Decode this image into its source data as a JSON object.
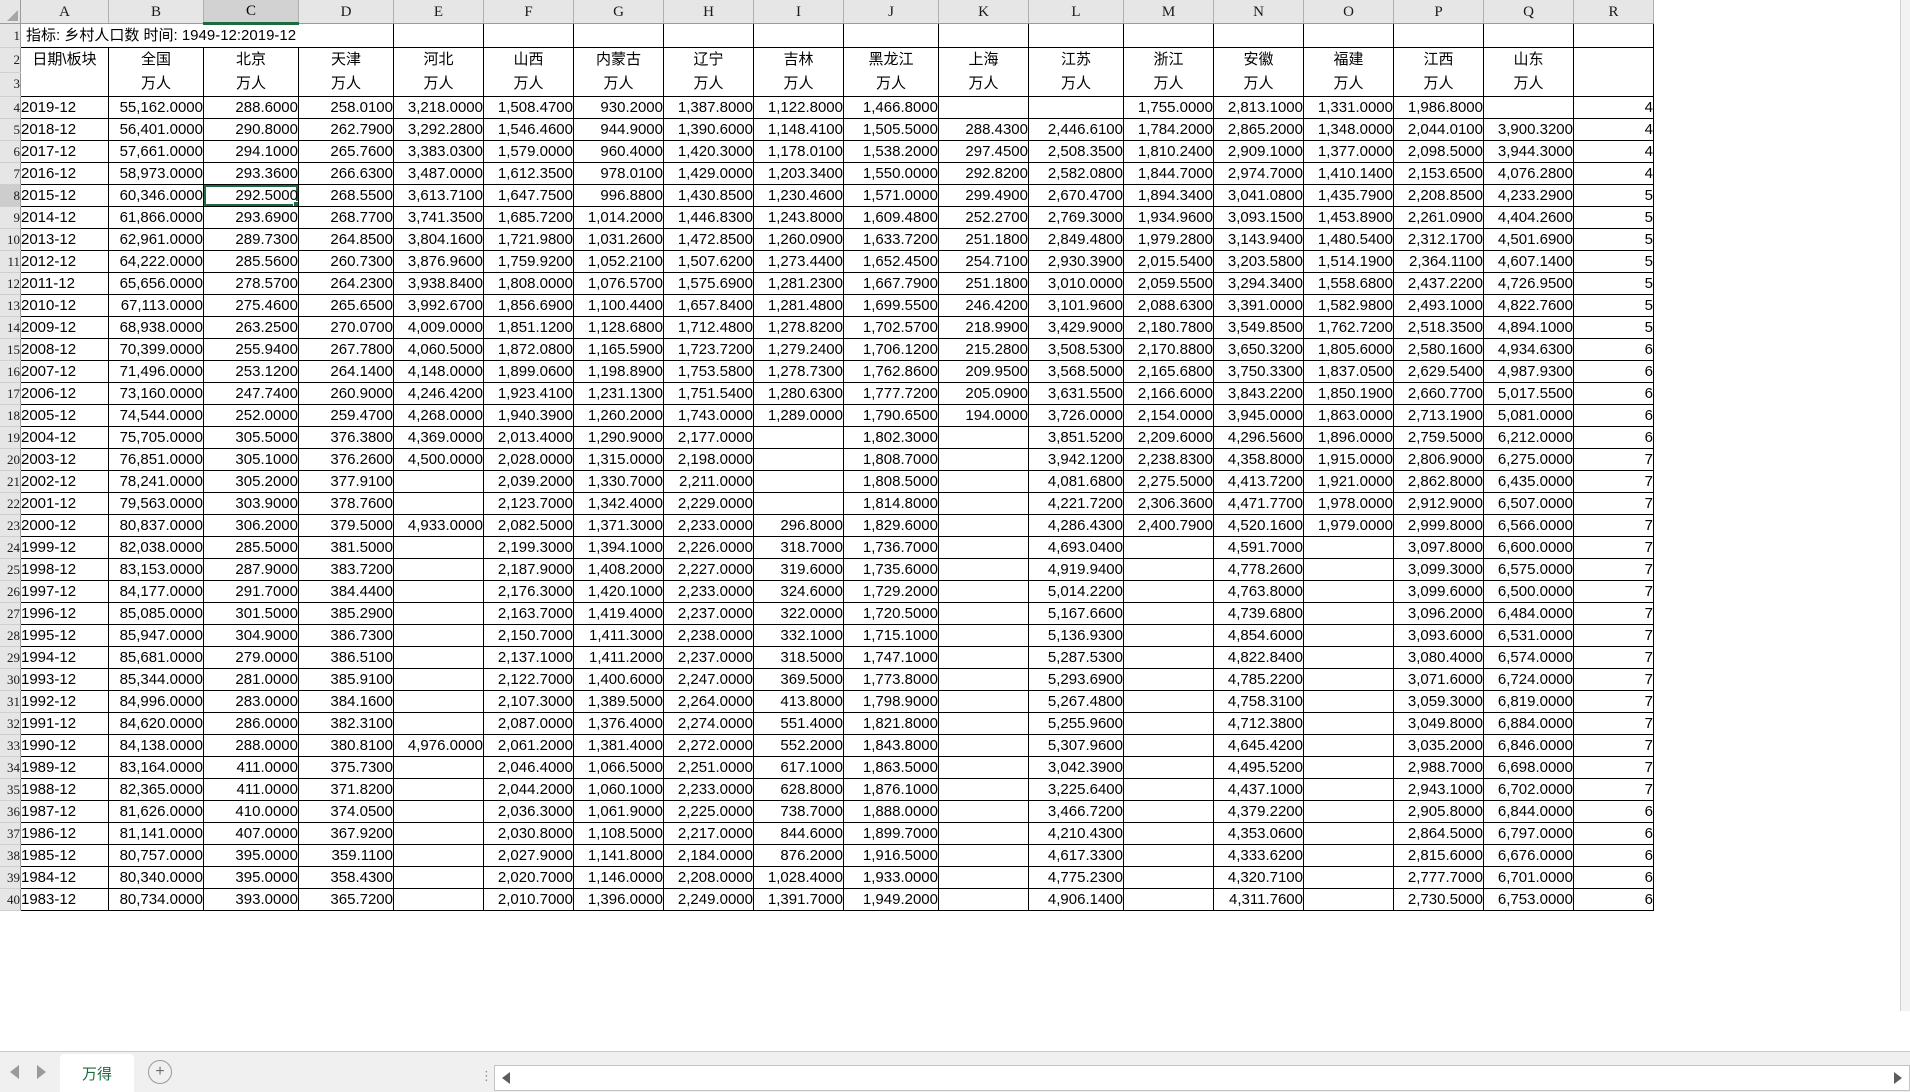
{
  "window": {
    "sheet_tab": "万得",
    "add_sheet_icon": "plus-circle-icon",
    "nav_prev_icon": "triangle-left-icon",
    "nav_next_icon": "triangle-right-icon",
    "hscroll_left_icon": "triangle-left-icon",
    "hscroll_right_icon": "triangle-right-icon",
    "accent_color": "#1e6b41"
  },
  "grid": {
    "column_letters": [
      "A",
      "B",
      "C",
      "D",
      "E",
      "F",
      "G",
      "H",
      "I",
      "J",
      "K",
      "L",
      "M",
      "N",
      "O",
      "P",
      "Q",
      "R"
    ],
    "selected_column": "C",
    "selected_cell": "C8",
    "selected_row_number": "8",
    "row_numbers": [
      "1",
      "2",
      "3",
      "4",
      "5",
      "6",
      "7",
      "8",
      "9",
      "10",
      "11",
      "12",
      "13",
      "14",
      "15",
      "16",
      "17",
      "18",
      "19",
      "20",
      "21",
      "22",
      "23",
      "24",
      "25",
      "26",
      "27",
      "28",
      "29",
      "30",
      "31",
      "32",
      "33",
      "34",
      "35",
      "36",
      "37",
      "38",
      "39",
      "40"
    ],
    "title": "指标: 乡村人口数  时间: 1949-12:2019-12",
    "header_label": "日期\\板块",
    "unit": "万人",
    "provinces": [
      "全国",
      "北京",
      "天津",
      "河北",
      "山西",
      "内蒙古",
      "辽宁",
      "吉林",
      "黑龙江",
      "上海",
      "江苏",
      "浙江",
      "安徽",
      "福建",
      "江西",
      "山东"
    ]
  },
  "chart_data": {
    "type": "table",
    "title": "指标: 乡村人口数  时间: 1949-12:2019-12",
    "ylabel": "万人",
    "categories": [
      "日期\\板块",
      "全国",
      "北京",
      "天津",
      "河北",
      "山西",
      "内蒙古",
      "辽宁",
      "吉林",
      "黑龙江",
      "上海",
      "江苏",
      "浙江",
      "安徽",
      "福建",
      "江西",
      "山东"
    ],
    "rows": [
      [
        "2019-12",
        "55,162.0000",
        "288.6000",
        "258.0100",
        "3,218.0000",
        "1,508.4700",
        "930.2000",
        "1,387.8000",
        "1,122.8000",
        "1,466.8000",
        "",
        "",
        "1,755.0000",
        "2,813.1000",
        "1,331.0000",
        "1,986.8000",
        "",
        "4"
      ],
      [
        "2018-12",
        "56,401.0000",
        "290.8000",
        "262.7900",
        "3,292.2800",
        "1,546.4600",
        "944.9000",
        "1,390.6000",
        "1,148.4100",
        "1,505.5000",
        "288.4300",
        "2,446.6100",
        "1,784.2000",
        "2,865.2000",
        "1,348.0000",
        "2,044.0100",
        "3,900.3200",
        "4"
      ],
      [
        "2017-12",
        "57,661.0000",
        "294.1000",
        "265.7600",
        "3,383.0300",
        "1,579.0000",
        "960.4000",
        "1,420.3000",
        "1,178.0100",
        "1,538.2000",
        "297.4500",
        "2,508.3500",
        "1,810.2400",
        "2,909.1000",
        "1,377.0000",
        "2,098.5000",
        "3,944.3000",
        "4"
      ],
      [
        "2016-12",
        "58,973.0000",
        "293.3600",
        "266.6300",
        "3,487.0000",
        "1,612.3500",
        "978.0100",
        "1,429.0000",
        "1,203.3400",
        "1,550.0000",
        "292.8200",
        "2,582.0800",
        "1,844.7000",
        "2,974.7000",
        "1,410.1400",
        "2,153.6500",
        "4,076.2800",
        "4"
      ],
      [
        "2015-12",
        "60,346.0000",
        "292.5000",
        "268.5500",
        "3,613.7100",
        "1,647.7500",
        "996.8800",
        "1,430.8500",
        "1,230.4600",
        "1,571.0000",
        "299.4900",
        "2,670.4700",
        "1,894.3400",
        "3,041.0800",
        "1,435.7900",
        "2,208.8500",
        "4,233.2900",
        "5"
      ],
      [
        "2014-12",
        "61,866.0000",
        "293.6900",
        "268.7700",
        "3,741.3500",
        "1,685.7200",
        "1,014.2000",
        "1,446.8300",
        "1,243.8000",
        "1,609.4800",
        "252.2700",
        "2,769.3000",
        "1,934.9600",
        "3,093.1500",
        "1,453.8900",
        "2,261.0900",
        "4,404.2600",
        "5"
      ],
      [
        "2013-12",
        "62,961.0000",
        "289.7300",
        "264.8500",
        "3,804.1600",
        "1,721.9800",
        "1,031.2600",
        "1,472.8500",
        "1,260.0900",
        "1,633.7200",
        "251.1800",
        "2,849.4800",
        "1,979.2800",
        "3,143.9400",
        "1,480.5400",
        "2,312.1700",
        "4,501.6900",
        "5"
      ],
      [
        "2012-12",
        "64,222.0000",
        "285.5600",
        "260.7300",
        "3,876.9600",
        "1,759.9200",
        "1,052.2100",
        "1,507.6200",
        "1,273.4400",
        "1,652.4500",
        "254.7100",
        "2,930.3900",
        "2,015.5400",
        "3,203.5800",
        "1,514.1900",
        "2,364.1100",
        "4,607.1400",
        "5"
      ],
      [
        "2011-12",
        "65,656.0000",
        "278.5700",
        "264.2300",
        "3,938.8400",
        "1,808.0000",
        "1,076.5700",
        "1,575.6900",
        "1,281.2300",
        "1,667.7900",
        "251.1800",
        "3,010.0000",
        "2,059.5500",
        "3,294.3400",
        "1,558.6800",
        "2,437.2200",
        "4,726.9500",
        "5"
      ],
      [
        "2010-12",
        "67,113.0000",
        "275.4600",
        "265.6500",
        "3,992.6700",
        "1,856.6900",
        "1,100.4400",
        "1,657.8400",
        "1,281.4800",
        "1,699.5500",
        "246.4200",
        "3,101.9600",
        "2,088.6300",
        "3,391.0000",
        "1,582.9800",
        "2,493.1000",
        "4,822.7600",
        "5"
      ],
      [
        "2009-12",
        "68,938.0000",
        "263.2500",
        "270.0700",
        "4,009.0000",
        "1,851.1200",
        "1,128.6800",
        "1,712.4800",
        "1,278.8200",
        "1,702.5700",
        "218.9900",
        "3,429.9000",
        "2,180.7800",
        "3,549.8500",
        "1,762.7200",
        "2,518.3500",
        "4,894.1000",
        "5"
      ],
      [
        "2008-12",
        "70,399.0000",
        "255.9400",
        "267.7800",
        "4,060.5000",
        "1,872.0800",
        "1,165.5900",
        "1,723.7200",
        "1,279.2400",
        "1,706.1200",
        "215.2800",
        "3,508.5300",
        "2,170.8800",
        "3,650.3200",
        "1,805.6000",
        "2,580.1600",
        "4,934.6300",
        "6"
      ],
      [
        "2007-12",
        "71,496.0000",
        "253.1200",
        "264.1400",
        "4,148.0000",
        "1,899.0600",
        "1,198.8900",
        "1,753.5800",
        "1,278.7300",
        "1,762.8600",
        "209.9500",
        "3,568.5000",
        "2,165.6800",
        "3,750.3300",
        "1,837.0500",
        "2,629.5400",
        "4,987.9300",
        "6"
      ],
      [
        "2006-12",
        "73,160.0000",
        "247.7400",
        "260.9000",
        "4,246.4200",
        "1,923.4100",
        "1,231.1300",
        "1,751.5400",
        "1,280.6300",
        "1,777.7200",
        "205.0900",
        "3,631.5500",
        "2,166.6000",
        "3,843.2200",
        "1,850.1900",
        "2,660.7700",
        "5,017.5500",
        "6"
      ],
      [
        "2005-12",
        "74,544.0000",
        "252.0000",
        "259.4700",
        "4,268.0000",
        "1,940.3900",
        "1,260.2000",
        "1,743.0000",
        "1,289.0000",
        "1,790.6500",
        "194.0000",
        "3,726.0000",
        "2,154.0000",
        "3,945.0000",
        "1,863.0000",
        "2,713.1900",
        "5,081.0000",
        "6"
      ],
      [
        "2004-12",
        "75,705.0000",
        "305.5000",
        "376.3800",
        "4,369.0000",
        "2,013.4000",
        "1,290.9000",
        "2,177.0000",
        "",
        "1,802.3000",
        "",
        "3,851.5200",
        "2,209.6000",
        "4,296.5600",
        "1,896.0000",
        "2,759.5000",
        "6,212.0000",
        "6"
      ],
      [
        "2003-12",
        "76,851.0000",
        "305.1000",
        "376.2600",
        "4,500.0000",
        "2,028.0000",
        "1,315.0000",
        "2,198.0000",
        "",
        "1,808.7000",
        "",
        "3,942.1200",
        "2,238.8300",
        "4,358.8000",
        "1,915.0000",
        "2,806.9000",
        "6,275.0000",
        "7"
      ],
      [
        "2002-12",
        "78,241.0000",
        "305.2000",
        "377.9100",
        "",
        "2,039.2000",
        "1,330.7000",
        "2,211.0000",
        "",
        "1,808.5000",
        "",
        "4,081.6800",
        "2,275.5000",
        "4,413.7200",
        "1,921.0000",
        "2,862.8000",
        "6,435.0000",
        "7"
      ],
      [
        "2001-12",
        "79,563.0000",
        "303.9000",
        "378.7600",
        "",
        "2,123.7000",
        "1,342.4000",
        "2,229.0000",
        "",
        "1,814.8000",
        "",
        "4,221.7200",
        "2,306.3600",
        "4,471.7700",
        "1,978.0000",
        "2,912.9000",
        "6,507.0000",
        "7"
      ],
      [
        "2000-12",
        "80,837.0000",
        "306.2000",
        "379.5000",
        "4,933.0000",
        "2,082.5000",
        "1,371.3000",
        "2,233.0000",
        "296.8000",
        "1,829.6000",
        "",
        "4,286.4300",
        "2,400.7900",
        "4,520.1600",
        "1,979.0000",
        "2,999.8000",
        "6,566.0000",
        "7"
      ],
      [
        "1999-12",
        "82,038.0000",
        "285.5000",
        "381.5000",
        "",
        "2,199.3000",
        "1,394.1000",
        "2,226.0000",
        "318.7000",
        "1,736.7000",
        "",
        "4,693.0400",
        "",
        "4,591.7000",
        "",
        "3,097.8000",
        "6,600.0000",
        "7"
      ],
      [
        "1998-12",
        "83,153.0000",
        "287.9000",
        "383.7200",
        "",
        "2,187.9000",
        "1,408.2000",
        "2,227.0000",
        "319.6000",
        "1,735.6000",
        "",
        "4,919.9400",
        "",
        "4,778.2600",
        "",
        "3,099.3000",
        "6,575.0000",
        "7"
      ],
      [
        "1997-12",
        "84,177.0000",
        "291.7000",
        "384.4400",
        "",
        "2,176.3000",
        "1,420.1000",
        "2,233.0000",
        "324.6000",
        "1,729.2000",
        "",
        "5,014.2200",
        "",
        "4,763.8000",
        "",
        "3,099.6000",
        "6,500.0000",
        "7"
      ],
      [
        "1996-12",
        "85,085.0000",
        "301.5000",
        "385.2900",
        "",
        "2,163.7000",
        "1,419.4000",
        "2,237.0000",
        "322.0000",
        "1,720.5000",
        "",
        "5,167.6600",
        "",
        "4,739.6800",
        "",
        "3,096.2000",
        "6,484.0000",
        "7"
      ],
      [
        "1995-12",
        "85,947.0000",
        "304.9000",
        "386.7300",
        "",
        "2,150.7000",
        "1,411.3000",
        "2,238.0000",
        "332.1000",
        "1,715.1000",
        "",
        "5,136.9300",
        "",
        "4,854.6000",
        "",
        "3,093.6000",
        "6,531.0000",
        "7"
      ],
      [
        "1994-12",
        "85,681.0000",
        "279.0000",
        "386.5100",
        "",
        "2,137.1000",
        "1,411.2000",
        "2,237.0000",
        "318.5000",
        "1,747.1000",
        "",
        "5,287.5300",
        "",
        "4,822.8400",
        "",
        "3,080.4000",
        "6,574.0000",
        "7"
      ],
      [
        "1993-12",
        "85,344.0000",
        "281.0000",
        "385.9100",
        "",
        "2,122.7000",
        "1,400.6000",
        "2,247.0000",
        "369.5000",
        "1,773.8000",
        "",
        "5,293.6900",
        "",
        "4,785.2200",
        "",
        "3,071.6000",
        "6,724.0000",
        "7"
      ],
      [
        "1992-12",
        "84,996.0000",
        "283.0000",
        "384.1600",
        "",
        "2,107.3000",
        "1,389.5000",
        "2,264.0000",
        "413.8000",
        "1,798.9000",
        "",
        "5,267.4800",
        "",
        "4,758.3100",
        "",
        "3,059.3000",
        "6,819.0000",
        "7"
      ],
      [
        "1991-12",
        "84,620.0000",
        "286.0000",
        "382.3100",
        "",
        "2,087.0000",
        "1,376.4000",
        "2,274.0000",
        "551.4000",
        "1,821.8000",
        "",
        "5,255.9600",
        "",
        "4,712.3800",
        "",
        "3,049.8000",
        "6,884.0000",
        "7"
      ],
      [
        "1990-12",
        "84,138.0000",
        "288.0000",
        "380.8100",
        "4,976.0000",
        "2,061.2000",
        "1,381.4000",
        "2,272.0000",
        "552.2000",
        "1,843.8000",
        "",
        "5,307.9600",
        "",
        "4,645.4200",
        "",
        "3,035.2000",
        "6,846.0000",
        "7"
      ],
      [
        "1989-12",
        "83,164.0000",
        "411.0000",
        "375.7300",
        "",
        "2,046.4000",
        "1,066.5000",
        "2,251.0000",
        "617.1000",
        "1,863.5000",
        "",
        "3,042.3900",
        "",
        "4,495.5200",
        "",
        "2,988.7000",
        "6,698.0000",
        "7"
      ],
      [
        "1988-12",
        "82,365.0000",
        "411.0000",
        "371.8200",
        "",
        "2,044.2000",
        "1,060.1000",
        "2,233.0000",
        "628.8000",
        "1,876.1000",
        "",
        "3,225.6400",
        "",
        "4,437.1000",
        "",
        "2,943.1000",
        "6,702.0000",
        "7"
      ],
      [
        "1987-12",
        "81,626.0000",
        "410.0000",
        "374.0500",
        "",
        "2,036.3000",
        "1,061.9000",
        "2,225.0000",
        "738.7000",
        "1,888.0000",
        "",
        "3,466.7200",
        "",
        "4,379.2200",
        "",
        "2,905.8000",
        "6,844.0000",
        "6"
      ],
      [
        "1986-12",
        "81,141.0000",
        "407.0000",
        "367.9200",
        "",
        "2,030.8000",
        "1,108.5000",
        "2,217.0000",
        "844.6000",
        "1,899.7000",
        "",
        "4,210.4300",
        "",
        "4,353.0600",
        "",
        "2,864.5000",
        "6,797.0000",
        "6"
      ],
      [
        "1985-12",
        "80,757.0000",
        "395.0000",
        "359.1100",
        "",
        "2,027.9000",
        "1,141.8000",
        "2,184.0000",
        "876.2000",
        "1,916.5000",
        "",
        "4,617.3300",
        "",
        "4,333.6200",
        "",
        "2,815.6000",
        "6,676.0000",
        "6"
      ],
      [
        "1984-12",
        "80,340.0000",
        "395.0000",
        "358.4300",
        "",
        "2,020.7000",
        "1,146.0000",
        "2,208.0000",
        "1,028.4000",
        "1,933.0000",
        "",
        "4,775.2300",
        "",
        "4,320.7100",
        "",
        "2,777.7000",
        "6,701.0000",
        "6"
      ],
      [
        "1983-12",
        "80,734.0000",
        "393.0000",
        "365.7200",
        "",
        "2,010.7000",
        "1,396.0000",
        "2,249.0000",
        "1,391.7000",
        "1,949.2000",
        "",
        "4,906.1400",
        "",
        "4,311.7600",
        "",
        "2,730.5000",
        "6,753.0000",
        "6"
      ]
    ]
  }
}
